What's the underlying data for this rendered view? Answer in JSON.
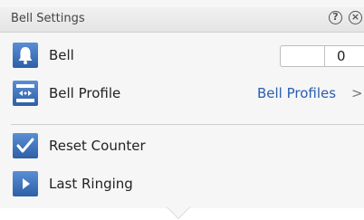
{
  "window": {
    "title": "Bell Settings",
    "help_icon": "help-icon",
    "close_icon": "close-icon",
    "help_glyph": "?",
    "close_glyph": "×"
  },
  "rows": {
    "bell": {
      "label": "Bell",
      "icon": "bell-icon",
      "counter_value": "0"
    },
    "bell_profile": {
      "label": "Bell Profile",
      "icon": "bell-profile-icon",
      "link": "Bell Profiles",
      "chevron": ">"
    },
    "reset_counter": {
      "label": "Reset Counter",
      "icon": "checkmark-icon"
    },
    "last_ringing": {
      "label": "Last Ringing",
      "icon": "play-icon"
    }
  },
  "colors": {
    "accent": "#2a5db0",
    "icon_bg": "#3a6fbf"
  }
}
